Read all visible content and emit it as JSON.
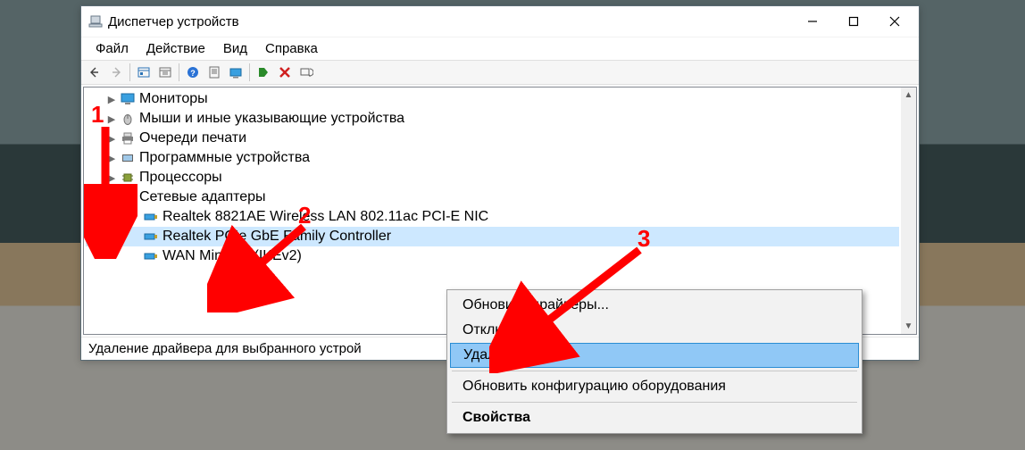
{
  "window_title": "Диспетчер устройств",
  "menubar": {
    "file": "Файл",
    "action": "Действие",
    "view": "Вид",
    "help": "Справка"
  },
  "tree": {
    "items": [
      {
        "label": "Мониторы",
        "type": "monitor"
      },
      {
        "label": "Мыши и иные указывающие устройства",
        "type": "mouse"
      },
      {
        "label": "Очереди печати",
        "type": "printer"
      },
      {
        "label": "Программные устройства",
        "type": "software"
      },
      {
        "label": "Процессоры",
        "type": "cpu"
      },
      {
        "label": "Сетевые адаптеры",
        "type": "network"
      }
    ],
    "adapters": [
      {
        "label": "Realtek 8821AE Wireless LAN 802.11ac PCI-E NIC"
      },
      {
        "label": "Realtek PCIe GbE Family Controller",
        "selected": true
      },
      {
        "label": "WAN Miniport (IKEv2)"
      }
    ]
  },
  "ctxmenu": {
    "update": "Обновить драйверы...",
    "disable": "Отключить",
    "delete": "Удалить",
    "scan": "Обновить конфигурацию оборудования",
    "properties": "Свойства"
  },
  "statusbar": "Удаление драйвера для выбранного устрой",
  "annotations": {
    "n1": "1",
    "n2": "2",
    "n3": "3"
  }
}
